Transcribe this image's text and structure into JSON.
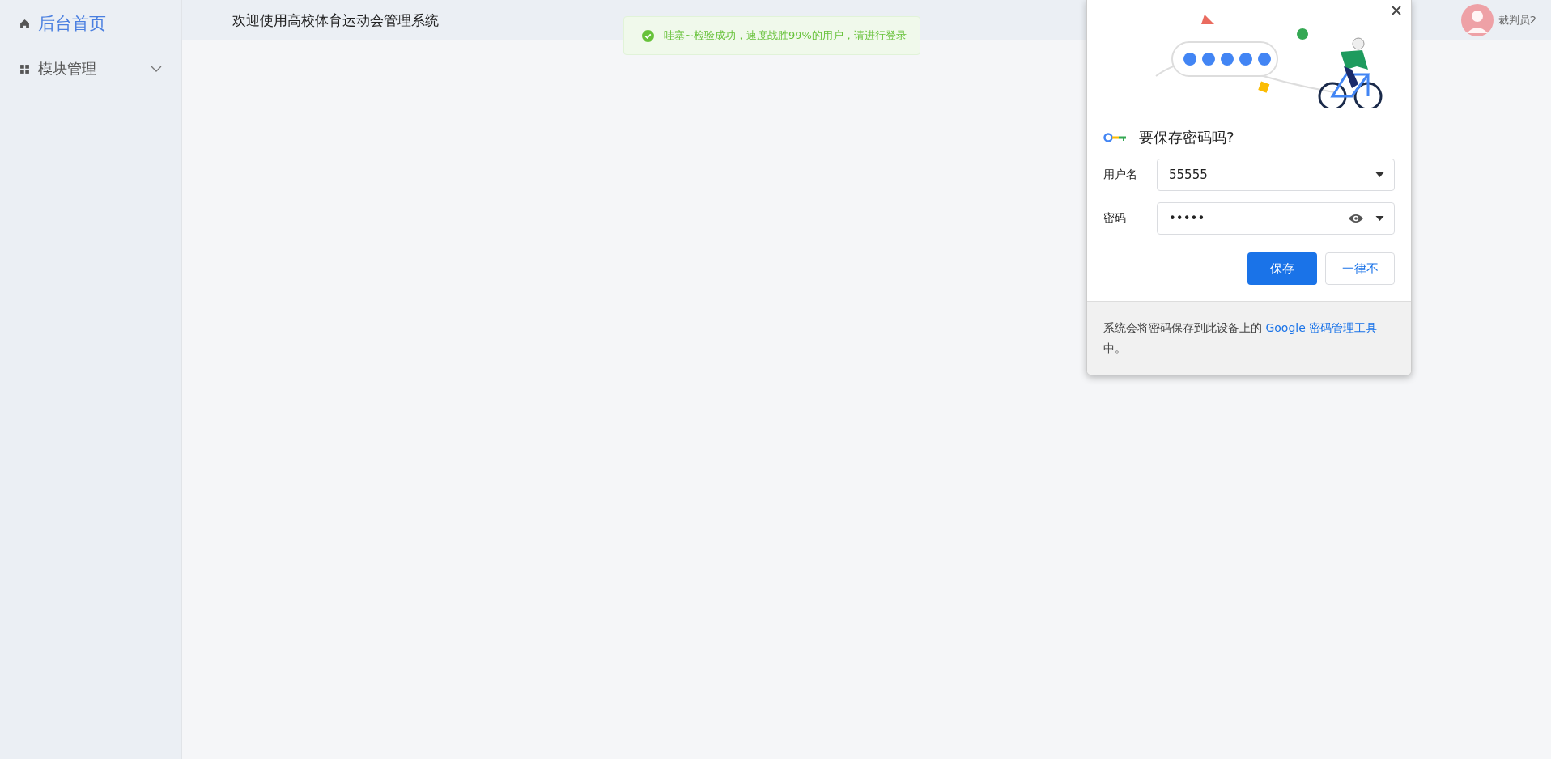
{
  "sidebar": {
    "items": [
      {
        "label": "后台首页",
        "selected": true,
        "expandable": false
      },
      {
        "label": "模块管理",
        "selected": false,
        "expandable": true
      }
    ]
  },
  "header": {
    "title": "欢迎使用高校体育运动会管理系统",
    "user": "裁判员2"
  },
  "toast": {
    "message": "哇塞~检验成功，速度战胜99%的用户，请进行登录"
  },
  "save_password_popup": {
    "title": "要保存密码吗?",
    "fields": [
      {
        "label": "用户名",
        "value": "55555",
        "reveal": false
      },
      {
        "label": "密码",
        "value": "•••••",
        "reveal": true
      }
    ],
    "buttons": [
      {
        "label": "保存",
        "primary": true
      },
      {
        "label": "一律不",
        "primary": false
      }
    ],
    "footer": {
      "text": "系统会将密码保存到此设备上的 ",
      "link": "Google 密码管理工具",
      "after": "中。"
    }
  }
}
